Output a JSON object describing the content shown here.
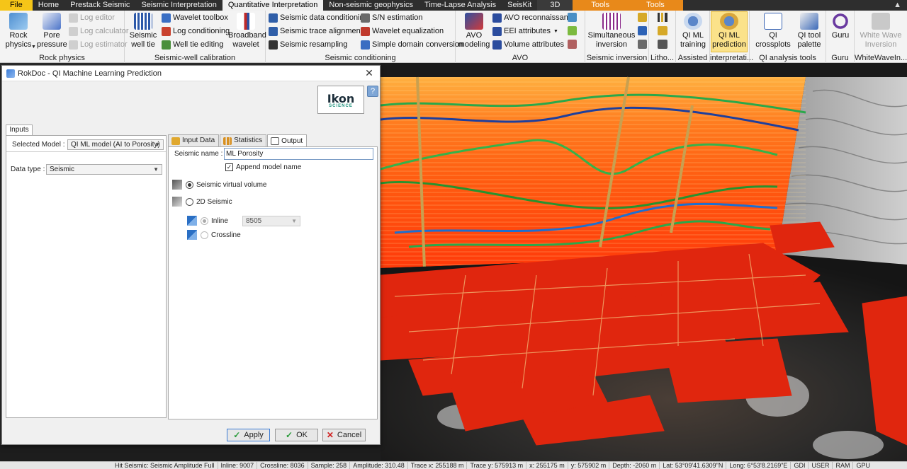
{
  "ribbon_tabs": [
    "File",
    "Home",
    "Prestack Seismic",
    "Seismic Interpretation",
    "Quantitative Interpretation",
    "Non-seismic geophysics",
    "Time-Lapse Analysis",
    "SeisKit",
    "3D",
    "Tools",
    "Tools"
  ],
  "ribbon_active_tab": "Quantitative Interpretation",
  "groups": {
    "rock_physics": {
      "label": "Rock physics",
      "rock_physics_btn": "Rock\nphysics",
      "pore_pressure_btn": "Pore\npressure",
      "log_editor": "Log editor",
      "log_calculator": "Log calculator",
      "log_estimator": "Log estimator"
    },
    "seismic_well": {
      "label": "Seismic-well calibration",
      "seismic_well_tie": "Seismic\nwell tie",
      "wavelet_toolbox": "Wavelet toolbox",
      "log_conditioning": "Log conditioning",
      "well_tie_editing": "Well tie editing",
      "broadband_wavelet": "Broadband\nwavelet"
    },
    "seismic_conditioning": {
      "label": "Seismic conditioning",
      "data_conditioning": "Seismic data conditioning",
      "trace_alignment": "Seismic trace alignment",
      "resampling": "Seismic resampling",
      "sn_estimation": "S/N estimation",
      "wavelet_equalization": "Wavelet equalization",
      "simple_domain": "Simple domain conversion"
    },
    "avo": {
      "label": "AVO",
      "avo_modeling": "AVO\nmodeling",
      "avo_recon": "AVO reconnaissance",
      "eei_attributes": "EEI attributes",
      "volume_attributes": "Volume attributes"
    },
    "seismic_inversion": {
      "label": "Seismic inversion",
      "simultaneous": "Simultaneous\ninversion"
    },
    "litho": {
      "label": "Litho..."
    },
    "qi_ml_assisted": {
      "label": "Assisted",
      "btn": "QI ML\ntraining"
    },
    "qi_ml_interp": {
      "label": "interpretati...",
      "btn": "QI ML\nprediction"
    },
    "qi_analysis": {
      "label": "QI analysis tools",
      "crossplots": "QI\ncrossplots",
      "palette": "QI tool\npalette"
    },
    "guru": {
      "label": "Guru",
      "btn": "Guru"
    },
    "whitewave": {
      "label": "WhiteWaveIn...",
      "btn": "White Wave\nInversion"
    }
  },
  "dialog": {
    "title": "RokDoc - QI Machine Learning Prediction",
    "logo_text": "Ikon",
    "logo_sub": "SCIENCE",
    "inputs_tab": "Inputs",
    "selected_model_label": "Selected Model :",
    "selected_model_value": "QI ML model (AI to Porosity)",
    "data_type_label": "Data type :",
    "data_type_value": "Seismic",
    "tabs": [
      "Input Data",
      "Statistics",
      "Output"
    ],
    "active_tab": "Output",
    "seismic_name_label": "Seismic name :",
    "seismic_name_value": "ML Porosity",
    "append_model_name": "Append model name",
    "append_checked": true,
    "virtual_volume_label": "Seismic virtual volume",
    "virtual_volume_selected": true,
    "seismic_2d_label": "2D Seismic",
    "inline_label": "Inline",
    "inline_value": "8505",
    "crossline_label": "Crossline",
    "buttons": {
      "apply": "Apply",
      "ok": "OK",
      "cancel": "Cancel"
    }
  },
  "statusbar": [
    "Hit Seismic: Seismic Amplitude Full",
    "Inline: 9007",
    "Crossline: 8036",
    "Sample: 258",
    "Amplitude: 310.48",
    "Trace x: 255188 m",
    "Trace y: 575913 m",
    "x: 255175 m",
    "y: 575902 m",
    "Depth: -2060 m",
    "Lat: 53°09'41.6309\"N",
    "Long: 6°53'8.2169\"E",
    "GDI",
    "USER",
    "RAM",
    "GPU"
  ],
  "colors": {
    "file_tab": "#f5c518",
    "tools_tab": "#e8891a",
    "selected_ribbon": "#fbe28a",
    "seismic_hot": "#ff5a10"
  }
}
